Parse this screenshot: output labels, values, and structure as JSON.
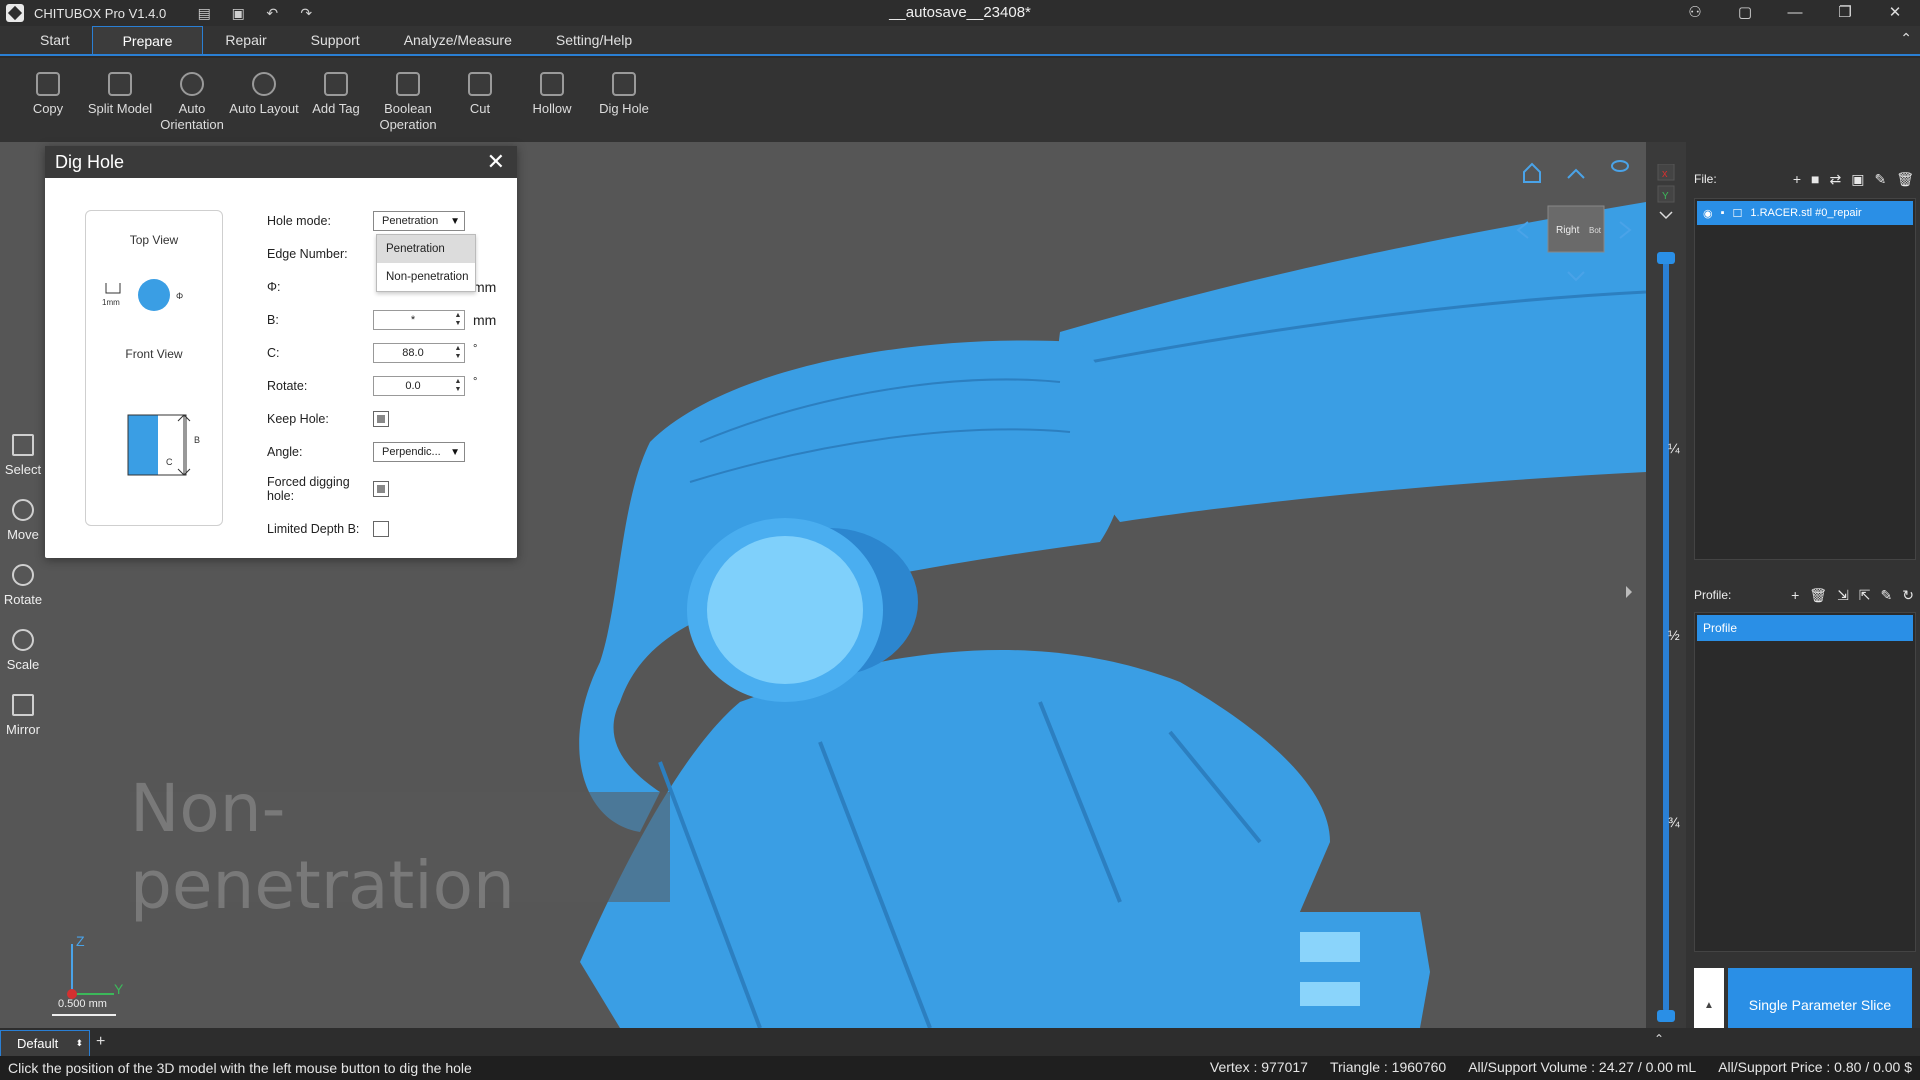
{
  "app": {
    "name": "CHITUBOX Pro V1.4.0",
    "doc_title": "__autosave__23408*"
  },
  "menu": {
    "items": [
      "Start",
      "Prepare",
      "Repair",
      "Support",
      "Analyze/Measure",
      "Setting/Help"
    ],
    "active": "Prepare"
  },
  "ribbon": {
    "buttons": [
      {
        "label": "Copy",
        "icon": "copy-icon"
      },
      {
        "label": "Split Model",
        "icon": "split-model-icon"
      },
      {
        "label": "Auto Orientation",
        "icon": "auto-orientation-icon"
      },
      {
        "label": "Auto Layout",
        "icon": "auto-layout-icon"
      },
      {
        "label": "Add Tag",
        "icon": "add-tag-icon"
      },
      {
        "label": "Boolean Operation",
        "icon": "boolean-operation-icon"
      },
      {
        "label": "Cut",
        "icon": "cut-icon"
      },
      {
        "label": "Hollow",
        "icon": "hollow-icon"
      },
      {
        "label": "Dig Hole",
        "icon": "dig-hole-icon"
      }
    ]
  },
  "left_tools": [
    {
      "label": "Select",
      "icon": "select-cursor-icon"
    },
    {
      "label": "Move",
      "icon": "move-icon"
    },
    {
      "label": "Rotate",
      "icon": "rotate-icon"
    },
    {
      "label": "Scale",
      "icon": "scale-icon"
    },
    {
      "label": "Mirror",
      "icon": "mirror-icon"
    }
  ],
  "dialog": {
    "title": "Dig Hole",
    "top_view": "Top View",
    "front_view": "Front View",
    "scale_marker": "1mm",
    "phi_marker": "Φ",
    "b_marker": "B",
    "c_marker": "C",
    "fields": {
      "hole_mode": {
        "label": "Hole mode:",
        "value": "Penetration"
      },
      "edge_number": {
        "label": "Edge Number:"
      },
      "phi": {
        "label": "Φ:",
        "unit": "mm"
      },
      "b": {
        "label": "B:",
        "value": "*",
        "unit": "mm"
      },
      "c": {
        "label": "C:",
        "value": "88.0",
        "unit": "°"
      },
      "rotate": {
        "label": "Rotate:",
        "value": "0.0",
        "unit": "°"
      },
      "keep_hole": {
        "label": "Keep Hole:",
        "checked": true
      },
      "angle": {
        "label": "Angle:",
        "value": "Perpendic..."
      },
      "forced": {
        "label": "Forced digging hole:",
        "checked": true
      },
      "limited_depth": {
        "label": "Limited Depth B:",
        "checked": false
      }
    },
    "dropdown_options": [
      "Penetration",
      "Non-penetration"
    ]
  },
  "viewport": {
    "watermark": "Non-penetration",
    "view_cube_labels": [
      "Right",
      "Bot"
    ],
    "axis_z": "Z",
    "axis_y": "Y",
    "scale_label": "0.500 mm",
    "model_color": "#3a9ee4"
  },
  "slider": {
    "fractions": [
      "¼",
      "½",
      "¾"
    ]
  },
  "right_panel": {
    "file_title": "File:",
    "file_item": "1.RACER.stl #0_repair",
    "profile_title": "Profile:",
    "profile_item": "Profile",
    "slice_button": "Single Parameter Slice"
  },
  "bottom": {
    "tab": "Default",
    "add": "+"
  },
  "status": {
    "hint": "Click the position of the 3D model with the left mouse button to dig the hole",
    "vertex": "Vertex : 977017",
    "triangle": "Triangle : 1960760",
    "volume": "All/Support Volume : 24.27 / 0.00 mL",
    "price": "All/Support Price : 0.80 / 0.00 $"
  },
  "colors": {
    "accent": "#2a8fe6",
    "model": "#3a9ee4",
    "viewport_bg": "#565656"
  }
}
